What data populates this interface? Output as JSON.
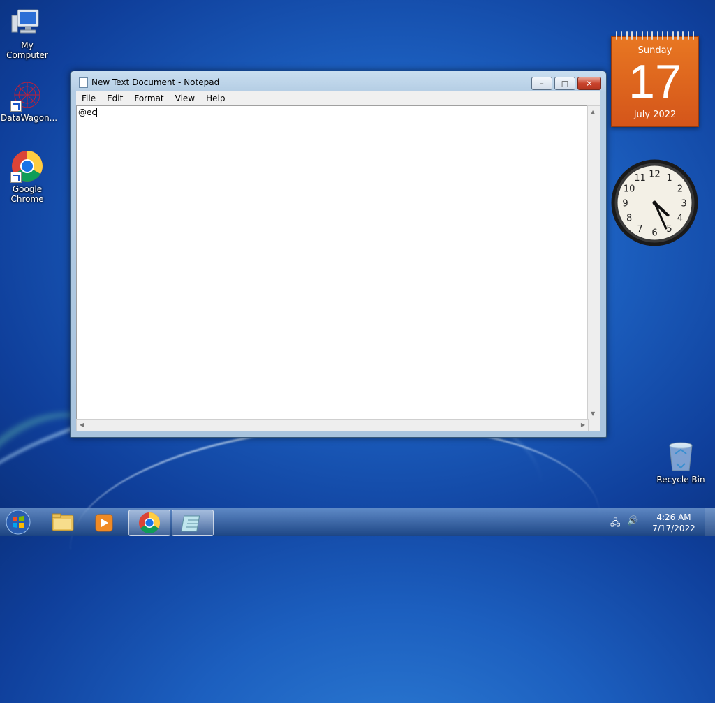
{
  "desktop": {
    "icons": [
      {
        "label": "My Computer"
      },
      {
        "label": "DataWagon..."
      },
      {
        "label": "Google Chrome"
      },
      {
        "label": "Recycle Bin"
      }
    ]
  },
  "notepad": {
    "title": "New Text Document - Notepad",
    "menu": [
      "File",
      "Edit",
      "Format",
      "View",
      "Help"
    ],
    "content": "@ec"
  },
  "calendar": {
    "day_name": "Sunday",
    "date": "17",
    "month_year": "July 2022"
  },
  "clock_gadget": {
    "numbers": [
      "12",
      "1",
      "2",
      "3",
      "4",
      "5",
      "6",
      "7",
      "8",
      "9",
      "10",
      "11"
    ],
    "time": "4:26"
  },
  "taskbar": {
    "time": "4:26 AM",
    "date": "7/17/2022",
    "items": [
      "start-button",
      "windows-explorer",
      "media-player",
      "google-chrome",
      "notepad"
    ]
  },
  "colors": {
    "desktop_blue": "#1c5fbf",
    "calendar_orange": "#e87722",
    "close_red": "#c9442d"
  }
}
